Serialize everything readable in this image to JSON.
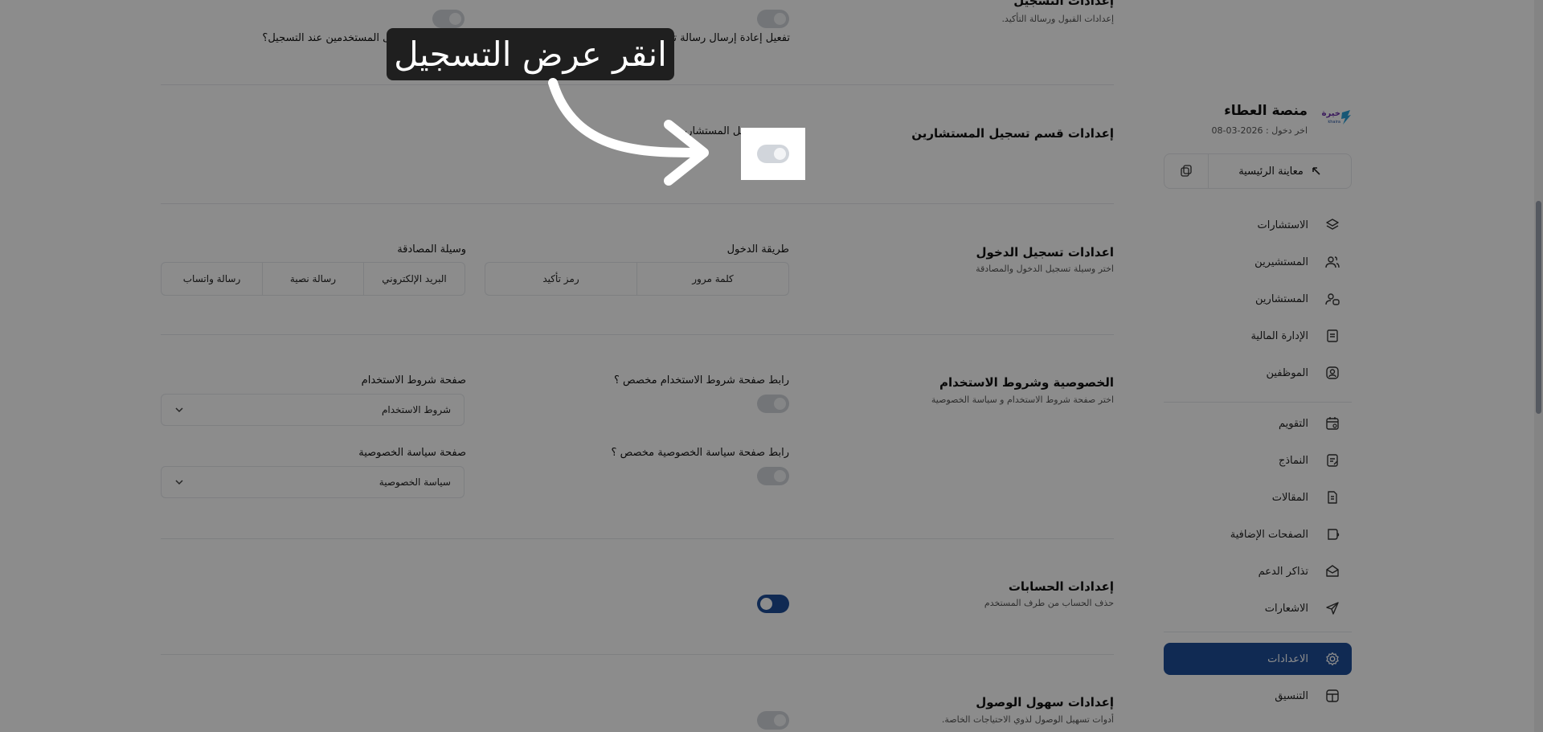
{
  "sidebar": {
    "brand_name": "منصة العطاء",
    "brand_date": "اخر دخول : 2026-03-08",
    "logo_word": "خيرة",
    "logo_sub": "khaira",
    "preview_label": "معاينة الرئيسية",
    "items": [
      {
        "label": "الاستشارات",
        "icon": "layers-icon"
      },
      {
        "label": "المستشيرين",
        "icon": "users-icon"
      },
      {
        "label": "المستشارين",
        "icon": "user-chat-icon"
      },
      {
        "label": "الإدارة المالية",
        "icon": "receipt-icon"
      },
      {
        "label": "الموظفين",
        "icon": "user-square-icon"
      },
      {
        "label": "التقويم",
        "icon": "calendar-icon"
      },
      {
        "label": "النماذج",
        "icon": "form-icon"
      },
      {
        "label": "المقالات",
        "icon": "article-icon"
      },
      {
        "label": "الصفحات الإضافية",
        "icon": "pages-icon"
      },
      {
        "label": "تذاكر الدعم",
        "icon": "ticket-icon"
      },
      {
        "label": "الاشعارات",
        "icon": "send-icon"
      },
      {
        "label": "الاعدادات",
        "icon": "gear-icon"
      },
      {
        "label": "التنسيق",
        "icon": "layout-icon"
      }
    ],
    "active_color": "#1e4d98"
  },
  "main": {
    "registration": {
      "title": "إعدادات التسجيل",
      "desc": "إعدادات القبول ورسالة التأكيد.",
      "option_resend": "تفعيل إعادة إرسال رسالة تأكيد الحسابات تلقائياً",
      "option_terms": "فرض الشروط على المستخدمين عند التسجيل؟"
    },
    "consultants_registration": {
      "title": "إعدادات قسم تسجيل المستشارين",
      "option_label": "عرض تسجيل المستشارين"
    },
    "login": {
      "title": "اعدادات تسجيل الدخول",
      "desc": "اختر وسيلة تسجيل الدخول والمصادقة",
      "method_label": "طريقة الدخول",
      "methods": [
        "كلمة مرور",
        "رمز تأكيد"
      ],
      "auth_label": "وسيلة المصادقة",
      "auth_options": [
        "البريد الإلكتروني",
        "رسالة نصية",
        "رسالة واتساب"
      ]
    },
    "privacy": {
      "title": "الخصوصية وشروط الاستخدام",
      "desc": "اختر صفحة شروط الاستخدام و سياسة الخصوصية",
      "custom_terms_label": "رابط صفحة شروط الاستخدام مخصص ؟",
      "terms_page_label": "صفحة شروط الاستخدام",
      "terms_page_value": "شروط الاستخدام",
      "custom_privacy_label": "رابط صفحة سياسة الخصوصية مخصص ؟",
      "privacy_page_label": "صفحة سياسة الخصوصية",
      "privacy_page_value": "سياسة الخصوصية"
    },
    "accounts": {
      "title": "إعدادات الحسابات",
      "desc": "حذف الحساب من طرف المستخدم",
      "delete_enabled": true
    },
    "accessibility": {
      "title": "إعدادات سهول الوصول",
      "desc": "أدوات تسهيل الوصول لذوي الاحتياجات الخاصة."
    }
  },
  "overlay": {
    "callout_text": "انقر عرض التسجيل"
  }
}
